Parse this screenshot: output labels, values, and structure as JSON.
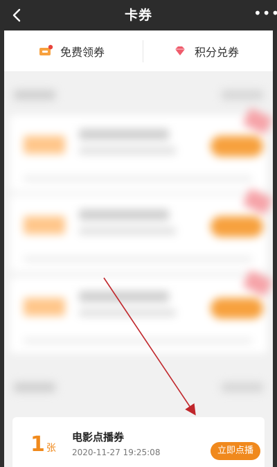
{
  "header": {
    "title": "卡券",
    "back_icon": "chevron-left-icon",
    "more_icon": "more-dots-icon",
    "more_text": "•••"
  },
  "tabs": [
    {
      "label": "免费领券",
      "icon": "ticket-icon",
      "icon_color": "#f7a13e",
      "dot_color": "#e8433b"
    },
    {
      "label": "积分兑券",
      "icon": "diamond-icon",
      "icon_color": "#ef5b6b"
    }
  ],
  "coupon": {
    "count": "1",
    "count_unit": "张",
    "name": "电影点播券",
    "time": "2020-11-27 19:25:08",
    "button_label": "立即点播"
  },
  "colors": {
    "accent": "#f0891d",
    "annotation_arrow": "#c0262b"
  }
}
